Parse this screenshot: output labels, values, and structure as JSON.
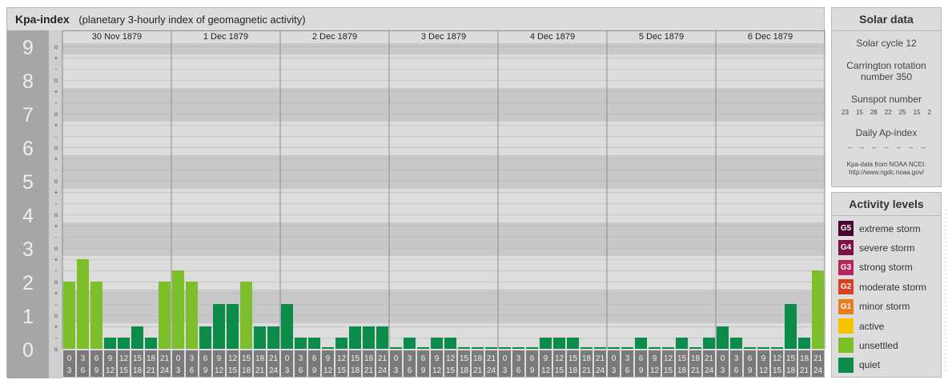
{
  "header": {
    "title": "Kpa-index",
    "subtitle": "(planetary 3-hourly index of geomagnetic activity)"
  },
  "chart_data": {
    "type": "bar",
    "title": "Kpa-index",
    "ylim": [
      0,
      9
    ],
    "y_ticks": [
      "0",
      "1",
      "2",
      "3",
      "4",
      "5",
      "6",
      "7",
      "8",
      "9"
    ],
    "y_subticks": [
      "o",
      "-",
      "+",
      "o",
      "-",
      "+",
      "o",
      "-",
      "+",
      "o",
      "-",
      "+",
      "o",
      "-",
      "+",
      "o",
      "-",
      "+",
      "o",
      "-",
      "+",
      "o",
      "-",
      "+",
      "o",
      "-",
      "+",
      "o"
    ],
    "days": [
      "30 Nov 1879",
      "1 Dec 1879",
      "2 Dec 1879",
      "3 Dec 1879",
      "4 Dec 1879",
      "5 Dec 1879",
      "6 Dec 1879"
    ],
    "interval_start_labels": [
      "0",
      "3",
      "6",
      "9",
      "12",
      "15",
      "18",
      "21"
    ],
    "interval_end_labels": [
      "3",
      "6",
      "9",
      "12",
      "15",
      "18",
      "21",
      "24"
    ],
    "values": [
      2.0,
      2.667,
      2.0,
      0.333,
      0.333,
      0.667,
      0.333,
      2.0,
      2.333,
      2.0,
      0.667,
      1.333,
      1.333,
      2.0,
      0.667,
      0.667,
      1.333,
      0.333,
      0.333,
      0,
      0.333,
      0.667,
      0.667,
      0.667,
      0,
      0.333,
      0,
      0.333,
      0.333,
      0,
      0,
      0,
      0,
      0,
      0,
      0.333,
      0.333,
      0.333,
      0,
      0,
      0,
      0,
      0.333,
      0,
      0,
      0.333,
      0,
      0.333,
      0.667,
      0.333,
      0,
      0,
      0,
      1.333,
      0.333,
      2.333
    ],
    "grid": true
  },
  "colors": {
    "quiet": "#0b8c4a",
    "unsettled": "#7cbf2a",
    "active": "#f5c400",
    "g1": "#e87d1e",
    "g2": "#d9401f",
    "g3": "#b8255a",
    "g4": "#7d1143",
    "g5": "#4a0630",
    "band_dark": "#c8c8c8",
    "band_light": "#dcdcdc",
    "axis_box": "#a6a6a6"
  },
  "solar": {
    "title": "Solar data",
    "cycle": "Solar cycle 12",
    "carrington": "Carrington rotation number 350",
    "ssn_label": "Sunspot number",
    "ssn_values": [
      "23",
      "15",
      "28",
      "22",
      "25",
      "15",
      "2"
    ],
    "ap_label": "Daily Ap-index",
    "ap_values": [
      "--",
      "--",
      "--",
      "--",
      "--",
      "--",
      "--"
    ],
    "source_line1": "Kpa-data from NOAA NCEI:",
    "source_line2": "http://www.ngdc.noaa.gov/"
  },
  "activity": {
    "title": "Activity levels",
    "items": [
      {
        "badge": "G5",
        "label": "extreme storm",
        "color": "#4a0630"
      },
      {
        "badge": "G4",
        "label": "severe storm",
        "color": "#7d1143"
      },
      {
        "badge": "G3",
        "label": "strong storm",
        "color": "#b8255a"
      },
      {
        "badge": "G2",
        "label": "moderate storm",
        "color": "#d9401f"
      },
      {
        "badge": "G1",
        "label": "minor storm",
        "color": "#e87d1e"
      },
      {
        "badge": "",
        "label": "active",
        "color": "#f5c400"
      },
      {
        "badge": "",
        "label": "unsettled",
        "color": "#7cbf2a"
      },
      {
        "badge": "",
        "label": "quiet",
        "color": "#0b8c4a"
      }
    ]
  }
}
